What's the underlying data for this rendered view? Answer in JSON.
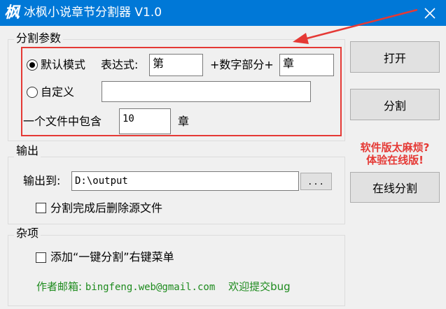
{
  "window": {
    "title": "冰枫小说章节分割器 V1.0",
    "app_icon_glyph": "枫",
    "titlebar_color": "#0078d7"
  },
  "params_group": {
    "legend": "分割参数",
    "default_mode_label": "默认模式",
    "expression_label": "表达式:",
    "prefix_value": "第",
    "number_part_label": "+数字部分+",
    "suffix_value": "章",
    "custom_label": "自定义",
    "custom_value": "",
    "per_file_label": "一个文件中包含",
    "per_file_value": "10",
    "per_file_unit": "章",
    "selected_mode": "default"
  },
  "output_group": {
    "legend": "输出",
    "output_to_label": "输出到:",
    "output_path": "D:\\output",
    "browse_label": "...",
    "delete_source_label": "分割完成后删除源文件",
    "delete_source_checked": false
  },
  "misc_group": {
    "legend": "杂项",
    "context_menu_label": "添加“一键分割”右键菜单",
    "context_menu_checked": false,
    "author_email_label": "作者邮箱:",
    "author_email": "bingfeng.web@gmail.com",
    "bug_report_text": "欢迎提交bug"
  },
  "buttons": {
    "open_label": "打开",
    "split_label": "分割",
    "online_split_label": "在线分割"
  },
  "promo": {
    "line1": "软件版太麻烦?",
    "line2": "体验在线版!"
  },
  "colors": {
    "annotation_red": "#e53935",
    "footer_green": "#1e8b1e"
  }
}
